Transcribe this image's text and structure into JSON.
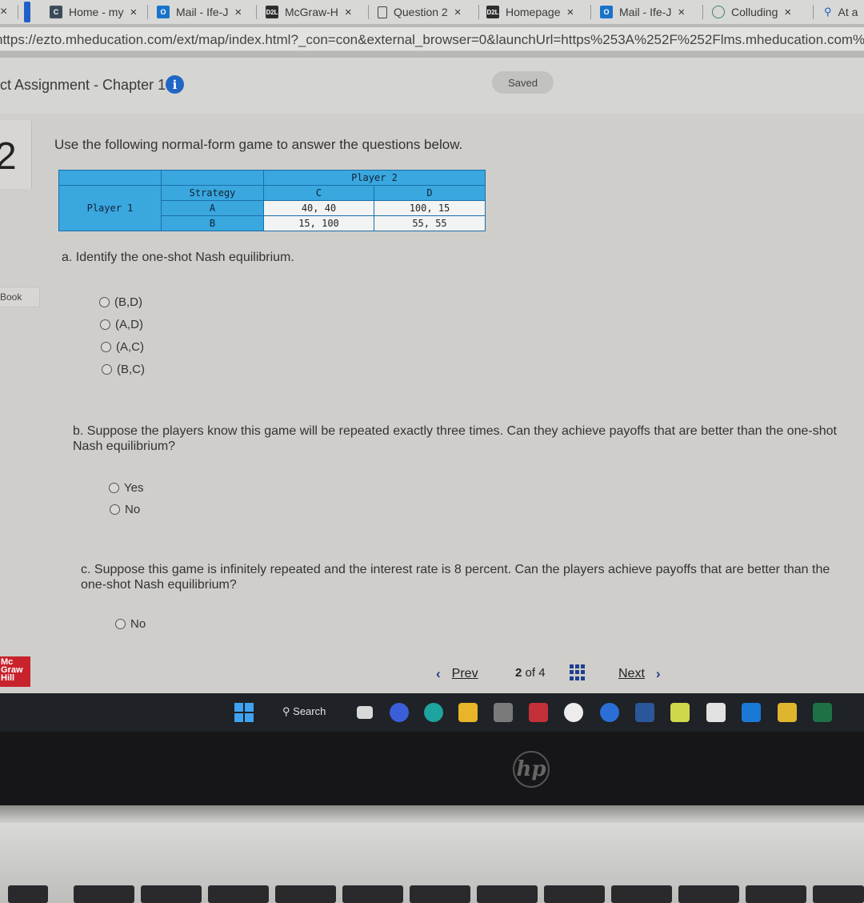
{
  "browser": {
    "tabs": [
      {
        "label": "",
        "icon": "close-icon",
        "close": "×"
      },
      {
        "label": "Home - my",
        "icon": "c-icon",
        "close": "×"
      },
      {
        "label": "Mail - Ife-J",
        "icon": "outlook-icon",
        "close": "×"
      },
      {
        "label": "McGraw-H",
        "icon": "d2l-icon",
        "close": "×"
      },
      {
        "label": "Question 2",
        "icon": "document-icon",
        "close": "×"
      },
      {
        "label": "Homepage",
        "icon": "d2l-icon",
        "close": "×"
      },
      {
        "label": "Mail - Ife-J",
        "icon": "outlook-icon",
        "close": "×"
      },
      {
        "label": "Colluding",
        "icon": "openai-icon",
        "close": "×"
      },
      {
        "label": "At a",
        "icon": "search-icon",
        "close": ""
      }
    ],
    "url": "https://ezto.mheducation.com/ext/map/index.html?_con=con&external_browser=0&launchUrl=https%253A%252F%252Flms.mheducation.com%252Fmghmidd"
  },
  "header": {
    "title": "ct Assignment - Chapter 10",
    "info_icon": "i",
    "saved": "Saved"
  },
  "question": {
    "number": "2",
    "intro": "Use the following normal-form game to answer the questions below.",
    "book_label": "Book",
    "table": {
      "player2": "Player 2",
      "player1": "Player 1",
      "strategy": "Strategy",
      "col_c": "C",
      "col_d": "D",
      "row_a": "A",
      "row_b": "B",
      "ac": "40, 40",
      "ad": "100, 15",
      "bc": "15, 100",
      "bd": "55, 55"
    },
    "part_a": {
      "text": "a. Identify the one-shot Nash equilibrium.",
      "options": [
        "(B,D)",
        "(A,D)",
        "(A,C)",
        "(B,C)"
      ]
    },
    "part_b": {
      "text": "b. Suppose the players know this game will be repeated exactly three times. Can they achieve payoffs that are better than the one-shot Nash equilibrium?",
      "options": [
        "Yes",
        "No"
      ]
    },
    "part_c": {
      "text": "c. Suppose this game is infinitely repeated and the interest rate is 8 percent. Can the players achieve payoffs that are better than the one-shot Nash equilibrium?",
      "options": [
        "No"
      ]
    }
  },
  "footer": {
    "logo": [
      "Mc",
      "Graw",
      "Hill"
    ],
    "prev": "Prev",
    "page_current": "2",
    "page_of": "of",
    "page_total": "4",
    "next": "Next"
  },
  "taskbar": {
    "search": "Search"
  },
  "laptop": {
    "brand": "hp"
  },
  "colors": {
    "table_header": "#3aa7df",
    "table_border": "#1b6fa8",
    "nav_accent": "#1f3a8a",
    "info_icon": "#2166c4"
  }
}
